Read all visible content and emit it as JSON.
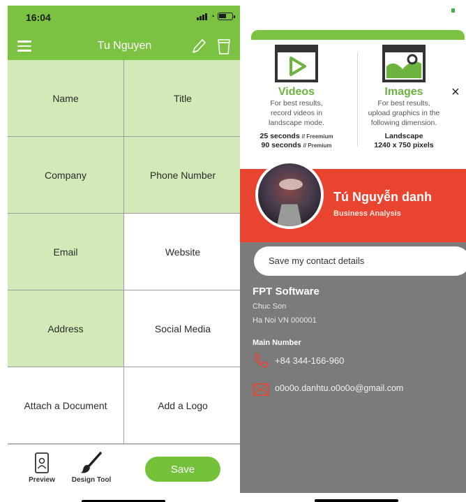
{
  "left_screen": {
    "status_bar": {
      "time": "16:04"
    },
    "header": {
      "title": "Tu Nguyen",
      "menu_icon": "hamburger-icon",
      "edit_icon": "pencil-icon",
      "delete_icon": "trash-icon"
    },
    "fields": [
      {
        "label": "Name",
        "filled": true
      },
      {
        "label": "Title",
        "filled": true
      },
      {
        "label": "Company",
        "filled": true
      },
      {
        "label": "Phone Number",
        "filled": true
      },
      {
        "label": "Email",
        "filled": true
      },
      {
        "label": "Website",
        "filled": false
      },
      {
        "label": "Address",
        "filled": true
      },
      {
        "label": "Social Media",
        "filled": false
      },
      {
        "label": "Attach a Document",
        "filled": false
      },
      {
        "label": "Add a Logo",
        "filled": false
      }
    ],
    "toolbar": {
      "preview_label": "Preview",
      "design_label": "Design Tool",
      "save_label": "Save"
    }
  },
  "right_screen": {
    "info": {
      "videos": {
        "heading": "Videos",
        "desc1": "For best results,",
        "desc2": "record videos in",
        "desc3": "landscape mode.",
        "spec1": "25 seconds",
        "spec1_tier": "// Freemium",
        "spec2": "90 seconds",
        "spec2_tier": "// Premium"
      },
      "images": {
        "heading": "Images",
        "desc1": "For best results,",
        "desc2": "upload graphics in the",
        "desc3": "following dimension.",
        "spec1": "Landscape",
        "spec2": "1240 x 750 pixels"
      },
      "close": "×"
    },
    "profile": {
      "name": "Tú Nguyễn danh",
      "role": "Business Analysis"
    },
    "details": {
      "save_contact": "Save my contact details",
      "company": "FPT Software",
      "address_line1": "Chuc Son",
      "address_line2": "Ha Noi VN 000001",
      "main_number_label": "Main Number",
      "phone": "+84 344-166-960",
      "email": "o0o0o.danhtu.o0o0o@gmail.com"
    }
  },
  "colors": {
    "brand_green": "#7cc242",
    "field_green": "#d2e9b8",
    "profile_red": "#e8442f",
    "details_gray": "#7b7b7b"
  }
}
